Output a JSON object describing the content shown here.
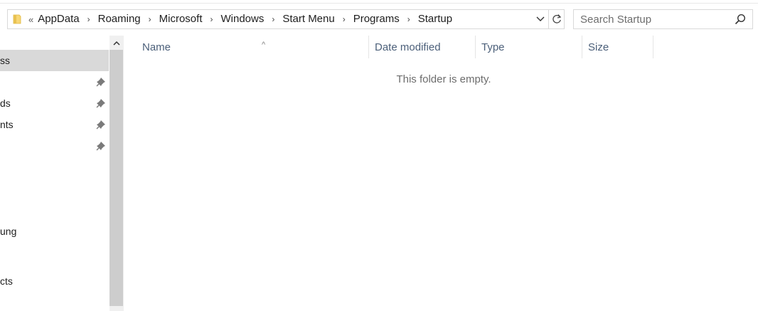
{
  "address": {
    "overflow_glyph": "«",
    "crumbs": [
      "AppData",
      "Roaming",
      "Microsoft",
      "Windows",
      "Start Menu",
      "Programs",
      "Startup"
    ],
    "separator": "›"
  },
  "search": {
    "placeholder": "Search Startup"
  },
  "nav": {
    "items": [
      {
        "label": "ss",
        "selected": true,
        "pinned": false
      },
      {
        "label": "",
        "pinned": true
      },
      {
        "label": "ds",
        "pinned": true
      },
      {
        "label": "nts",
        "pinned": true
      },
      {
        "label": "",
        "pinned": true
      },
      {
        "label": "ung",
        "pinned": false
      },
      {
        "label": "cts",
        "pinned": false
      }
    ]
  },
  "columns": {
    "name": "Name",
    "date_modified": "Date modified",
    "type": "Type",
    "size": "Size",
    "sort_indicator": "^"
  },
  "content": {
    "empty_message": "This folder is empty."
  },
  "colors": {
    "header_text": "#4c607a",
    "selected_nav_bg": "#d9d9d9",
    "scroll_thumb": "#cdcdcd",
    "folder_yellow": "#f8d775"
  }
}
